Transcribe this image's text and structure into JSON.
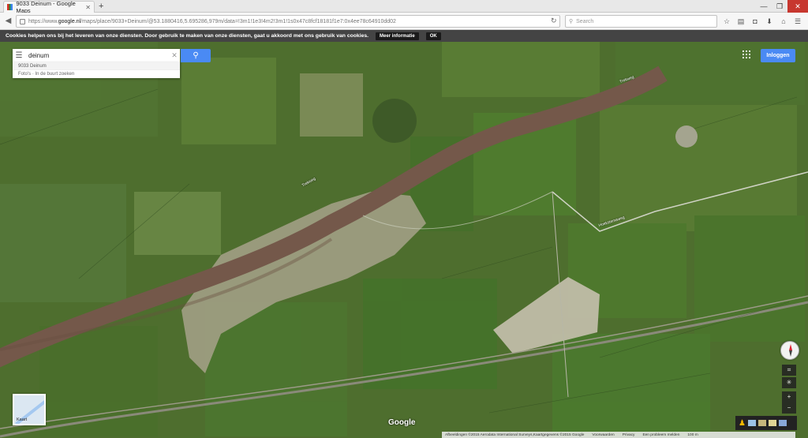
{
  "browser": {
    "tab_title": "9033 Deinum - Google Maps",
    "url_prefix": "https://www.",
    "url_host": "google.nl",
    "url_rest": "/maps/place/9033+Deinum/@53.1880416,5.695286,979m/data=!3m1!1e3!4m2!3m1!1s0x47c8fcf18181f1e7:0x4ee78c64910dd02",
    "search_placeholder": "Search"
  },
  "cookie_bar": {
    "text": "Cookies helpen ons bij het leveren van onze diensten. Door gebruik te maken van onze diensten, gaat u akkoord met ons gebruik van cookies.",
    "more_info": "Meer informatie",
    "ok": "OK"
  },
  "search": {
    "value": "deinum",
    "suggestion": "9033 Deinum",
    "secondary": "Foto's · In de buurt zoeken"
  },
  "header": {
    "login": "Inloggen"
  },
  "thumbnail": {
    "label": "Kaart"
  },
  "map_labels": {
    "road1": "Trekweg",
    "road2": "Trekweg",
    "road3": "Hoekstemaweg"
  },
  "footer": {
    "imagery": "Afbeeldingen ©2015 Aerodata International Surveys,Kaartgegevens ©2015 Google",
    "terms": "Voorwaarden",
    "privacy": "Privacy",
    "report": "Een probleem melden",
    "scale": "100 m"
  },
  "logo": "Google"
}
